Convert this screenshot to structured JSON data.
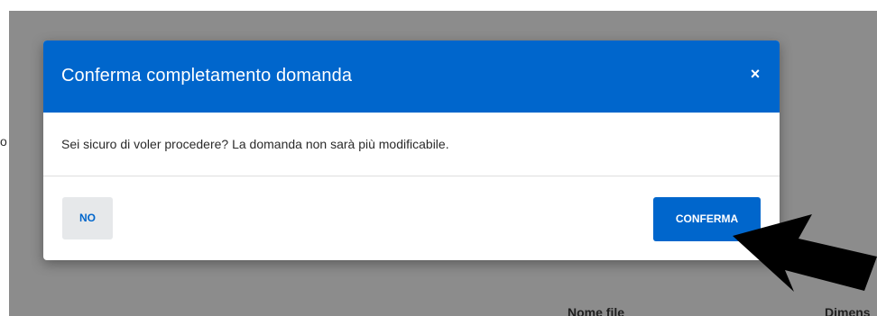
{
  "background": {
    "left_fragment": "o",
    "column_nome_file": "Nome file",
    "column_dimensione": "Dimens"
  },
  "modal": {
    "title": "Conferma completamento domanda",
    "close_label": "×",
    "message": "Sei sicuro di voler procedere? La domanda non sarà più modificabile.",
    "no_label": "NO",
    "confirm_label": "CONFERMA"
  },
  "colors": {
    "primary": "#0066cc",
    "overlay": "#8c8c8c",
    "secondary_button": "#e6e8ea"
  },
  "annotation": {
    "icon": "arrow-pointer-icon",
    "color": "#000000"
  }
}
